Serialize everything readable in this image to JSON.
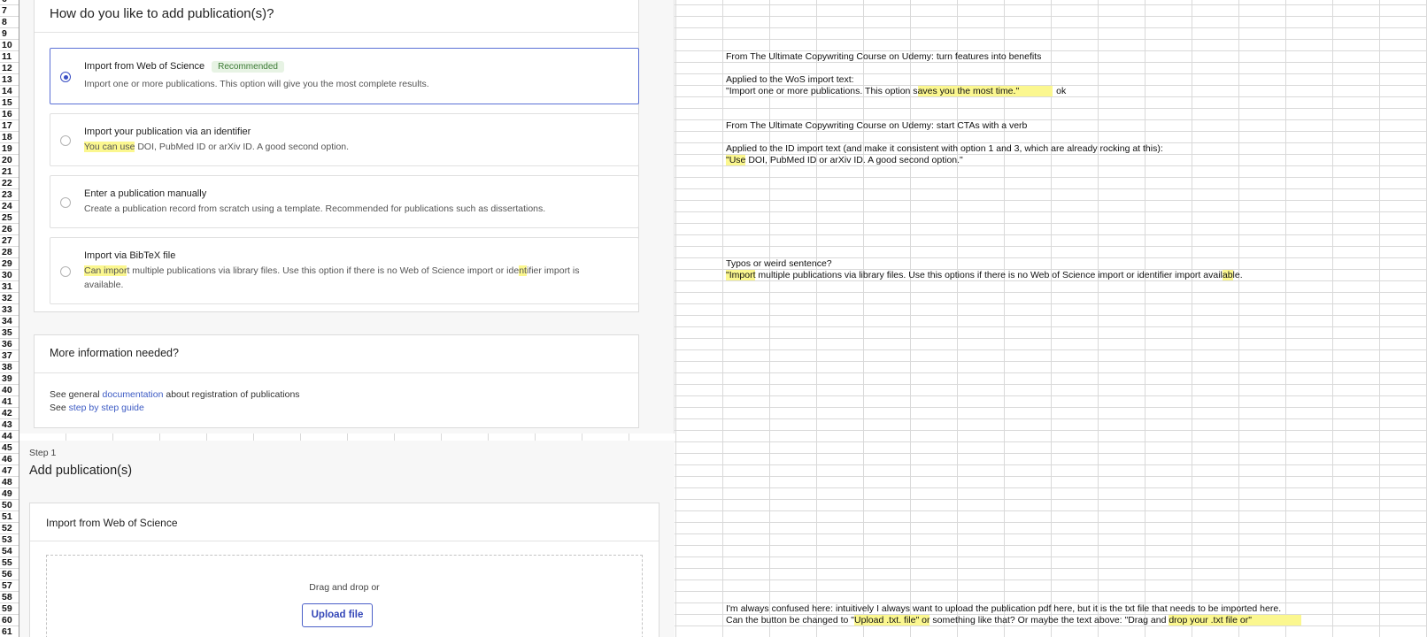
{
  "row_numbers": [
    "6",
    "7",
    "8",
    "9",
    "10",
    "11",
    "12",
    "13",
    "14",
    "15",
    "16",
    "17",
    "18",
    "19",
    "20",
    "21",
    "22",
    "23",
    "24",
    "25",
    "26",
    "27",
    "28",
    "29",
    "30",
    "31",
    "32",
    "33",
    "34",
    "35",
    "36",
    "37",
    "38",
    "39",
    "40",
    "41",
    "42",
    "43",
    "44",
    "45",
    "46",
    "47",
    "48",
    "49",
    "50",
    "51",
    "52",
    "53",
    "54",
    "55",
    "56",
    "57",
    "58",
    "59",
    "60",
    "61"
  ],
  "panel1": {
    "question": "How do you like to add publication(s)?",
    "options": [
      {
        "title": "Import from Web of Science",
        "badge": "Recommended",
        "desc": "Import one or more publications. This option will give you the most complete results.",
        "selected": true
      },
      {
        "title": "Import your publication via an identifier",
        "desc_hl": "You can use",
        "desc_rest": " DOI, PubMed ID or arXiv ID. A good second option.",
        "selected": false
      },
      {
        "title": "Enter a publication manually",
        "desc": "Create a publication record from scratch using a template. Recommended for publications such as dissertations.",
        "selected": false
      },
      {
        "title": "Import via BibTeX file",
        "desc_p1": "Can impor",
        "desc_p2": "t multiple publications via library files. Use this option if there is no Web of Science import or ide",
        "desc_p3": "nt",
        "desc_p4": "ifier import is",
        "desc_line2": "available.",
        "selected": false
      }
    ],
    "more_info": {
      "title": "More information needed?",
      "line1_pre": "See general ",
      "line1_link": "documentation",
      "line1_post": " about registration of publications",
      "line2_pre": "See ",
      "line2_link": "step by step guide"
    }
  },
  "panel2": {
    "step": "Step 1",
    "title": "Add publication(s)",
    "card_title": "Import from Web of Science",
    "drag_text": "Drag and drop or",
    "upload_label": "Upload file"
  },
  "notes": {
    "r11": "From The Ultimate Copywriting Course on Udemy: turn features into benefits",
    "r13": "Applied to the WoS import text:",
    "r14_pre": "\"Import one or more publications. This option s",
    "r14_hl": "aves you the most time.\"",
    "r14_ok": "ok",
    "r17": "From The Ultimate Copywriting Course on Udemy: start CTAs with a verb",
    "r19": "Applied to the ID import text (and make it consistent with option 1 and 3, which are already rocking at this):",
    "r20_hl": "\"Use",
    "r20_rest": " DOI, PubMed ID or arXiv ID. A good second option.\"",
    "r29": "Typos or weird sentence?",
    "r30_hl1": "\"Import",
    "r30_mid": " multiple publications via library files. Use this options if there is no Web of Science import or identifier import avail",
    "r30_hl2": "ab",
    "r30_end": "le.",
    "r59": "I'm always confused here: intuitively I always want to upload the publication pdf here, but it is the txt file that needs to be imported here.",
    "r60_pre": "Can the button be changed to \"",
    "r60_hl1": "Upload .txt. file\" or",
    "r60_mid": " something like that? Or maybe the text above: \"Drag and ",
    "r60_hl2": "drop your .txt file or\""
  }
}
